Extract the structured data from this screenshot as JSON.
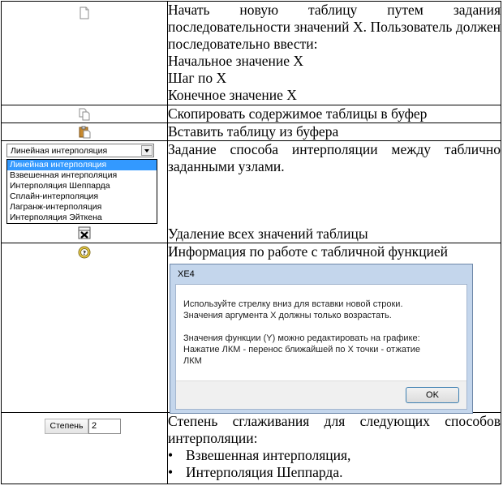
{
  "rows": {
    "new_table": {
      "icon": "new-document-icon",
      "lines": [
        "Начать новую таблицу путем задания последовательности значений X. Пользователь должен последовательно ввести:",
        "Начальное значение X",
        "Шаг по X",
        "Конечное значение X"
      ]
    },
    "copy": {
      "icon": "copy-icon",
      "text": "Скопировать содержимое таблицы в буфер"
    },
    "paste": {
      "icon": "paste-icon",
      "text": "Вставить таблицу из буфера"
    },
    "interp": {
      "text": "Задание способа интерполяции между таблично заданными узлами.",
      "combo_value": "Линейная интерполяция",
      "options": [
        "Линейная интерполяция",
        "Взвешенная интерполяция",
        "Интерполяция Шеппарда",
        "Сплайн-интерполяция",
        "Лагранж-интерполяция",
        "Интерполяция Эйткена"
      ],
      "delete_icon": "delete-table-icon",
      "delete_text": "Удаление всех значений таблицы"
    },
    "help": {
      "icon": "help-icon",
      "text": "Информация по работе с табличной функцией",
      "dialog": {
        "title": "XE4",
        "line1": "Используйте стрелку вниз для вставки новой строки.",
        "line2": "Значения аргумента X должны только возрастать.",
        "line3": "Значения функции (Y) можно редактировать на графике:",
        "line4": "Нажатие ЛКМ - перенос ближайшей по X точки - отжатие",
        "line5": "ЛКМ",
        "ok": "OK"
      }
    },
    "degree": {
      "label": "Степень",
      "value": "2",
      "text": "Степень сглаживания для следующих способов интерполяции:",
      "bullets": [
        "Взвешенная интерполяция,",
        "Интерполяция Шеппарда."
      ]
    }
  }
}
